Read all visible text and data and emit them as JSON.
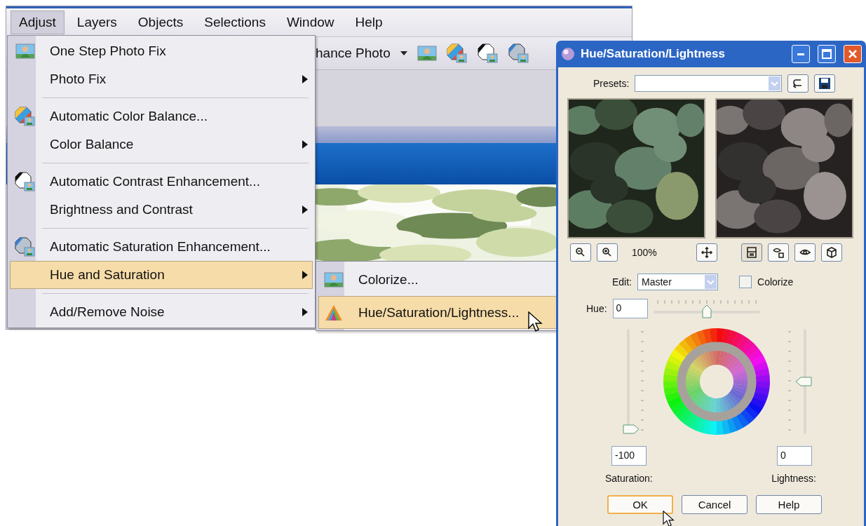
{
  "menubar": [
    {
      "label": "Adjust",
      "selected": true
    },
    {
      "label": "Layers",
      "selected": false
    },
    {
      "label": "Objects",
      "selected": false
    },
    {
      "label": "Selections",
      "selected": false
    },
    {
      "label": "Window",
      "selected": false
    },
    {
      "label": "Help",
      "selected": false
    }
  ],
  "toolbar": {
    "dropdown": "hance Photo"
  },
  "adjust_menu": [
    {
      "kind": "item",
      "label": "One Step Photo Fix",
      "submenu": false,
      "selected": false
    },
    {
      "kind": "item",
      "label": "Photo Fix",
      "submenu": true,
      "selected": false
    },
    {
      "kind": "separator"
    },
    {
      "kind": "item",
      "label": "Automatic Color Balance...",
      "submenu": false,
      "selected": false
    },
    {
      "kind": "item",
      "label": "Color Balance",
      "submenu": true,
      "selected": false
    },
    {
      "kind": "separator"
    },
    {
      "kind": "item",
      "label": "Automatic Contrast Enhancement...",
      "submenu": false,
      "selected": false
    },
    {
      "kind": "item",
      "label": "Brightness and Contrast",
      "submenu": true,
      "selected": false
    },
    {
      "kind": "separator"
    },
    {
      "kind": "item",
      "label": "Automatic Saturation Enhancement...",
      "submenu": false,
      "selected": false
    },
    {
      "kind": "item",
      "label": "Hue and Saturation",
      "submenu": true,
      "selected": true
    },
    {
      "kind": "separator"
    },
    {
      "kind": "item",
      "label": "Add/Remove Noise",
      "submenu": true,
      "selected": false
    }
  ],
  "submenu": [
    {
      "label": "Colorize...",
      "selected": false
    },
    {
      "label": "Hue/Saturation/Lightness...",
      "selected": true
    }
  ],
  "dialog": {
    "title": "Hue/Saturation/Lightness",
    "presets_label": "Presets:",
    "zoom": "100%",
    "edit_label": "Edit:",
    "edit_value": "Master",
    "colorize": {
      "label": "Colorize",
      "checked": false
    },
    "hue": {
      "label": "Hue:",
      "value": "0",
      "level": 0.5
    },
    "saturation": {
      "label": "Saturation:",
      "value": "-100",
      "level": 0
    },
    "lightness": {
      "label": "Lightness:",
      "value": "0",
      "level": 0.5
    },
    "buttons": [
      {
        "label": "OK",
        "selected": true
      },
      {
        "label": "Cancel",
        "selected": false
      },
      {
        "label": "Help",
        "selected": false
      }
    ]
  }
}
